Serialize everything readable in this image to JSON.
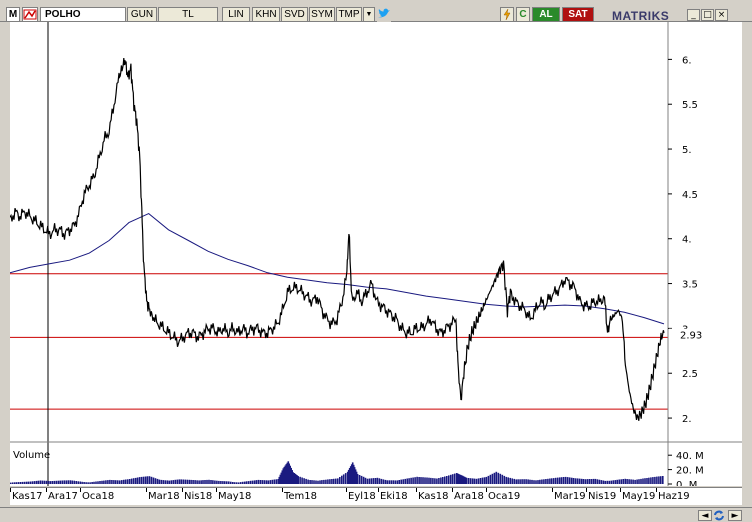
{
  "toolbar": {
    "menu_label": "M",
    "symbol": "POLHO",
    "period": "GUN",
    "currency": "TL",
    "lin": "LIN",
    "khn": "KHN",
    "svd": "SVD",
    "sym": "SYM",
    "tmp": "TMP",
    "dropdown": "▼",
    "c_label": "C",
    "buy": "AL",
    "sell": "SAT",
    "brand": "MATRIKS",
    "win_min": "_",
    "win_max": "□",
    "win_close": "×"
  },
  "colors": {
    "price": "#000000",
    "moving_average": "#1a1a80",
    "support_resistance": "#cc0000",
    "volume": "#1a1a80",
    "buy": "#2a8a2a",
    "sell": "#b01010"
  },
  "icons": {
    "logo": "polho-logo-icon",
    "twitter": "twitter-icon",
    "bolt": "lightning-icon",
    "refresh": "refresh-icon",
    "scroll_left": "chevron-left-icon",
    "scroll_right": "chevron-right-icon"
  },
  "chart_data": {
    "type": "line",
    "x_labels": [
      "Kas17",
      "Ara17",
      "Oca18",
      "Mar18",
      "Nis18",
      "May18",
      "Tem18",
      "Eyl18",
      "Eki18",
      "Kas18",
      "Ara18",
      "Oca19",
      "Mar19",
      "Nis19",
      "May19",
      "Haz19"
    ],
    "y_ticks": [
      "6.",
      "5.5",
      "5.",
      "4.5",
      "4.",
      "3.5",
      "3.",
      "2.5",
      "2."
    ],
    "last_price_label": "2.93",
    "ylim": [
      1.8,
      6.35
    ],
    "horizontal_lines": [
      3.61,
      2.9,
      2.1
    ],
    "price_series": [
      [
        0,
        4.2
      ],
      [
        5,
        4.3
      ],
      [
        10,
        4.25
      ],
      [
        15,
        4.3
      ],
      [
        20,
        4.25
      ],
      [
        25,
        4.2
      ],
      [
        30,
        4.15
      ],
      [
        35,
        4.1
      ],
      [
        40,
        4.05
      ],
      [
        45,
        4.1
      ],
      [
        50,
        4.1
      ],
      [
        55,
        4.05
      ],
      [
        60,
        4.1
      ],
      [
        65,
        4.15
      ],
      [
        70,
        4.3
      ],
      [
        75,
        4.5
      ],
      [
        80,
        4.6
      ],
      [
        85,
        4.7
      ],
      [
        90,
        4.9
      ],
      [
        95,
        5.1
      ],
      [
        100,
        5.2
      ],
      [
        105,
        5.5
      ],
      [
        110,
        5.8
      ],
      [
        113,
        5.9
      ],
      [
        116,
        6.0
      ],
      [
        119,
        5.8
      ],
      [
        122,
        5.9
      ],
      [
        125,
        5.5
      ],
      [
        128,
        5.3
      ],
      [
        131,
        4.9
      ],
      [
        133,
        4.3
      ],
      [
        135,
        3.7
      ],
      [
        138,
        3.3
      ],
      [
        141,
        3.2
      ],
      [
        145,
        3.1
      ],
      [
        150,
        3.05
      ],
      [
        155,
        3.0
      ],
      [
        160,
        2.95
      ],
      [
        165,
        2.9
      ],
      [
        170,
        2.85
      ],
      [
        175,
        2.9
      ],
      [
        180,
        2.95
      ],
      [
        185,
        2.95
      ],
      [
        190,
        2.9
      ],
      [
        195,
        2.95
      ],
      [
        200,
        3.0
      ],
      [
        205,
        3.0
      ],
      [
        210,
        2.95
      ],
      [
        215,
        3.0
      ],
      [
        220,
        2.95
      ],
      [
        225,
        3.0
      ],
      [
        230,
        2.95
      ],
      [
        235,
        3.0
      ],
      [
        240,
        2.95
      ],
      [
        245,
        3.0
      ],
      [
        250,
        3.0
      ],
      [
        255,
        2.95
      ],
      [
        260,
        2.95
      ],
      [
        265,
        3.0
      ],
      [
        270,
        3.05
      ],
      [
        275,
        3.2
      ],
      [
        280,
        3.4
      ],
      [
        285,
        3.45
      ],
      [
        290,
        3.45
      ],
      [
        295,
        3.4
      ],
      [
        300,
        3.35
      ],
      [
        305,
        3.3
      ],
      [
        310,
        3.35
      ],
      [
        315,
        3.2
      ],
      [
        320,
        3.1
      ],
      [
        325,
        3.05
      ],
      [
        330,
        3.1
      ],
      [
        335,
        3.3
      ],
      [
        340,
        3.6
      ],
      [
        342,
        4.1
      ],
      [
        345,
        3.3
      ],
      [
        350,
        3.4
      ],
      [
        355,
        3.3
      ],
      [
        360,
        3.4
      ],
      [
        365,
        3.5
      ],
      [
        370,
        3.3
      ],
      [
        375,
        3.25
      ],
      [
        380,
        3.2
      ],
      [
        385,
        3.15
      ],
      [
        390,
        3.1
      ],
      [
        395,
        3.0
      ],
      [
        400,
        2.95
      ],
      [
        405,
        2.95
      ],
      [
        410,
        3.0
      ],
      [
        415,
        3.0
      ],
      [
        420,
        3.05
      ],
      [
        425,
        3.1
      ],
      [
        430,
        3.0
      ],
      [
        435,
        2.95
      ],
      [
        440,
        3.0
      ],
      [
        445,
        3.05
      ],
      [
        450,
        3.1
      ],
      [
        452,
        2.6
      ],
      [
        455,
        2.2
      ],
      [
        458,
        2.5
      ],
      [
        462,
        2.8
      ],
      [
        466,
        2.95
      ],
      [
        470,
        3.05
      ],
      [
        474,
        3.15
      ],
      [
        478,
        3.25
      ],
      [
        482,
        3.35
      ],
      [
        486,
        3.45
      ],
      [
        490,
        3.55
      ],
      [
        494,
        3.65
      ],
      [
        498,
        3.72
      ],
      [
        502,
        3.2
      ],
      [
        505,
        3.4
      ],
      [
        510,
        3.3
      ],
      [
        515,
        3.25
      ],
      [
        520,
        3.2
      ],
      [
        525,
        3.1
      ],
      [
        530,
        3.2
      ],
      [
        535,
        3.3
      ],
      [
        540,
        3.25
      ],
      [
        545,
        3.35
      ],
      [
        550,
        3.4
      ],
      [
        555,
        3.45
      ],
      [
        560,
        3.55
      ],
      [
        565,
        3.5
      ],
      [
        570,
        3.45
      ],
      [
        575,
        3.3
      ],
      [
        580,
        3.25
      ],
      [
        585,
        3.25
      ],
      [
        590,
        3.3
      ],
      [
        595,
        3.3
      ],
      [
        600,
        3.35
      ],
      [
        603,
        2.95
      ],
      [
        606,
        3.1
      ],
      [
        610,
        3.15
      ],
      [
        614,
        3.2
      ],
      [
        618,
        3.1
      ],
      [
        621,
        2.6
      ],
      [
        625,
        2.3
      ],
      [
        629,
        2.1
      ],
      [
        633,
        2.0
      ],
      [
        637,
        2.05
      ],
      [
        641,
        2.15
      ],
      [
        645,
        2.3
      ],
      [
        649,
        2.5
      ],
      [
        653,
        2.7
      ],
      [
        657,
        2.9
      ],
      [
        660,
        2.95
      ]
    ],
    "ma_series": [
      [
        0,
        3.62
      ],
      [
        20,
        3.68
      ],
      [
        40,
        3.72
      ],
      [
        60,
        3.76
      ],
      [
        80,
        3.84
      ],
      [
        100,
        3.98
      ],
      [
        120,
        4.18
      ],
      [
        140,
        4.28
      ],
      [
        160,
        4.1
      ],
      [
        180,
        3.98
      ],
      [
        200,
        3.86
      ],
      [
        220,
        3.77
      ],
      [
        240,
        3.7
      ],
      [
        260,
        3.62
      ],
      [
        280,
        3.57
      ],
      [
        300,
        3.54
      ],
      [
        320,
        3.51
      ],
      [
        340,
        3.49
      ],
      [
        360,
        3.46
      ],
      [
        380,
        3.44
      ],
      [
        400,
        3.4
      ],
      [
        420,
        3.36
      ],
      [
        440,
        3.33
      ],
      [
        460,
        3.3
      ],
      [
        480,
        3.27
      ],
      [
        500,
        3.25
      ],
      [
        520,
        3.24
      ],
      [
        540,
        3.25
      ],
      [
        560,
        3.26
      ],
      [
        580,
        3.25
      ],
      [
        600,
        3.22
      ],
      [
        620,
        3.18
      ],
      [
        640,
        3.12
      ],
      [
        660,
        3.05
      ]
    ],
    "volume_label": "Volume",
    "volume_ticks": [
      "40. M",
      "20. M",
      "0. M"
    ],
    "volume_max": 50,
    "volume_series": [
      [
        0,
        2
      ],
      [
        10,
        2
      ],
      [
        20,
        2
      ],
      [
        30,
        3
      ],
      [
        40,
        2
      ],
      [
        50,
        3
      ],
      [
        60,
        4
      ],
      [
        70,
        3
      ],
      [
        80,
        2
      ],
      [
        90,
        3
      ],
      [
        100,
        4
      ],
      [
        110,
        3
      ],
      [
        120,
        5
      ],
      [
        130,
        8
      ],
      [
        140,
        10
      ],
      [
        150,
        6
      ],
      [
        160,
        4
      ],
      [
        170,
        5
      ],
      [
        180,
        4
      ],
      [
        190,
        3
      ],
      [
        200,
        4
      ],
      [
        210,
        3
      ],
      [
        220,
        3
      ],
      [
        230,
        2
      ],
      [
        240,
        3
      ],
      [
        250,
        4
      ],
      [
        260,
        3
      ],
      [
        270,
        5
      ],
      [
        275,
        20
      ],
      [
        280,
        30
      ],
      [
        285,
        15
      ],
      [
        290,
        10
      ],
      [
        300,
        6
      ],
      [
        310,
        4
      ],
      [
        320,
        5
      ],
      [
        330,
        6
      ],
      [
        340,
        15
      ],
      [
        345,
        28
      ],
      [
        350,
        12
      ],
      [
        360,
        6
      ],
      [
        370,
        8
      ],
      [
        380,
        5
      ],
      [
        390,
        4
      ],
      [
        400,
        6
      ],
      [
        410,
        8
      ],
      [
        420,
        7
      ],
      [
        430,
        6
      ],
      [
        440,
        10
      ],
      [
        450,
        15
      ],
      [
        455,
        12
      ],
      [
        460,
        8
      ],
      [
        470,
        6
      ],
      [
        480,
        8
      ],
      [
        490,
        15
      ],
      [
        500,
        8
      ],
      [
        510,
        5
      ],
      [
        520,
        6
      ],
      [
        530,
        5
      ],
      [
        540,
        6
      ],
      [
        550,
        7
      ],
      [
        560,
        8
      ],
      [
        570,
        6
      ],
      [
        580,
        5
      ],
      [
        590,
        6
      ],
      [
        600,
        4
      ],
      [
        610,
        5
      ],
      [
        620,
        6
      ],
      [
        630,
        4
      ],
      [
        640,
        6
      ],
      [
        650,
        8
      ],
      [
        660,
        10
      ]
    ]
  }
}
